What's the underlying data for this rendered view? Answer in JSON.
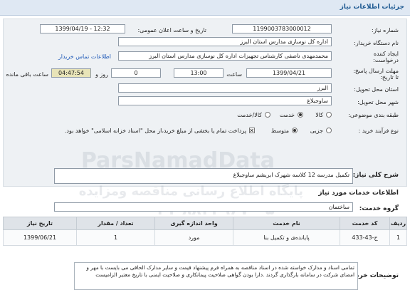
{
  "page": {
    "header_title": "جزئیات اطلاعات نیاز"
  },
  "form": {
    "need_number_label": "شماره نیاز:",
    "need_number": "1199003783000012",
    "announce_label": "تاریخ و ساعت اعلان عمومی:",
    "announce_value": "1399/04/19 - 12:32",
    "buyer_label": "نام دستگاه خریدار:",
    "buyer_value": "اداره کل نوسازی مدارس استان البرز",
    "creator_label_1": "ایجاد کننده",
    "creator_label_2": "درخواست:",
    "creator_value": "محمدمهدی ناصفی کارشناس تجهیزات اداره کل نوسازی مدارس استان البرز",
    "contact_link": "اطلاعات تماس خریدار",
    "deadline_label_1": "مهلت ارسال پاسخ:",
    "deadline_label_2": "تا تاریخ:",
    "deadline_date": "1399/04/21",
    "time_label": "ساعت",
    "deadline_time": "13:00",
    "days_value": "0",
    "days_label": "روز و",
    "remaining_value": "04:47:54",
    "remaining_label": "ساعت باقی مانده",
    "province_label": "استان محل تحویل:",
    "province_value": "البرز",
    "city_label": "شهر محل تحویل:",
    "city_value": "ساوجبلاغ",
    "category_label": "طبقه بندی موضوعی:",
    "category_options": [
      "کالا",
      "خدمت",
      "کالا/خدمت"
    ],
    "process_label": "نوع فرآیند خرید :",
    "process_options": [
      "جزیی",
      "متوسط"
    ],
    "payment_note": "پرداخت تمام یا بخشی از مبلغ خرید،از محل \"اسناد خزانه اسلامی\" خواهد بود."
  },
  "summary": {
    "label": "شرح کلی نیاز:",
    "value": "تکمیل مدرسه 12 کلاسه شهرک ابریشم ساوجبلاغ"
  },
  "services": {
    "section_title": "اطلاعات خدمات مورد نیاز",
    "group_label": "گروه خدمت:",
    "group_value": "ساختمان",
    "columns": [
      "ردیف",
      "کد خدمت",
      "نام خدمت",
      "واحد اندازه گیری",
      "تعداد / مقدار",
      "تاریخ نیاز"
    ],
    "rows": [
      [
        "1",
        "ج-43-433",
        "پایانده‌ی و تکمیل بنا",
        "مورد",
        "1",
        "1399/06/21"
      ]
    ]
  },
  "buyer_notes": {
    "label": "توضیحات خریدار:",
    "text": "تمامی اسناد و مدارک خواسته شده در اسناد مناقصه به همراه فرم پیشنهاد قیمت و سایر مدارک الحاقی می بایست با مهر و امضای شرکت در سامانه بارگذاری گردند .دارا بودن گواهی صلاحیت پیمانکاری و صلاحیت ایمنی با تاریخ معتبر الزامیست"
  },
  "watermarks": [
    "ParsNamadData",
    "پایگاه اطلاع رسانی مناقصه ومزایده",
    "۰۲۱-۸۸۳۴۹۶۷۰-۵"
  ]
}
